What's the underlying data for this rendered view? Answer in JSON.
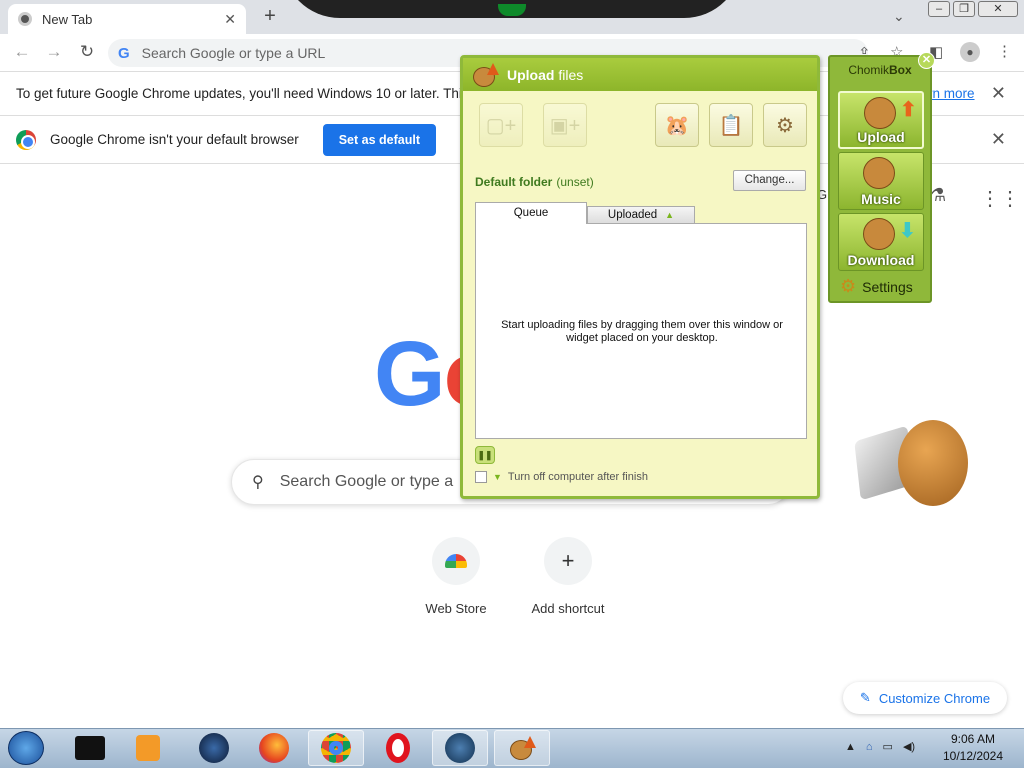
{
  "browser": {
    "tab_title": "New Tab",
    "omnibox_placeholder": "Search Google or type a URL",
    "update_bar_text": "To get future Google Chrome updates, you'll need Windows 10 or later. This c",
    "update_bar_link": "rn more",
    "default_bar_text": "Google Chrome isn't your default browser",
    "set_default_label": "Set as default"
  },
  "ntp": {
    "logo_fragment": "Go",
    "search_placeholder": "Search Google or type a",
    "shortcuts": [
      {
        "label": "Web Store",
        "icon": "webstore-icon"
      },
      {
        "label": "Add shortcut",
        "icon": "plus-icon"
      }
    ],
    "gmail_fragment": "G",
    "customize_label": "Customize Chrome"
  },
  "upload_window": {
    "title_bold": "Upload",
    "title_rest": "files",
    "default_folder_label": "Default folder",
    "default_folder_value": "(unset)",
    "change_button": "Change...",
    "tabs": [
      {
        "label": "Queue",
        "active": true
      },
      {
        "label": "Uploaded",
        "active": false
      }
    ],
    "queue_message": "Start uploading files by dragging them over this window or widget placed on your desktop.",
    "turn_off_label": "Turn off computer after finish"
  },
  "widget": {
    "title_normal": "Chomik",
    "title_bold": "Box",
    "buttons": [
      {
        "label": "Upload",
        "icon": "hamster-upload-icon"
      },
      {
        "label": "Music",
        "icon": "hamster-headphones-icon"
      },
      {
        "label": "Download",
        "icon": "hamster-download-icon"
      }
    ],
    "settings_label": "Settings"
  },
  "taskbar": {
    "time": "9:06 AM",
    "date": "10/12/2024",
    "apps": [
      "terminal",
      "media-player",
      "system-app",
      "firefox",
      "chrome",
      "opera",
      "steam",
      "chomikbox"
    ]
  },
  "colors": {
    "chrome_blue": "#1a73e8",
    "chomik_green": "#8fb93a",
    "window_bg": "#f6f7c4"
  }
}
